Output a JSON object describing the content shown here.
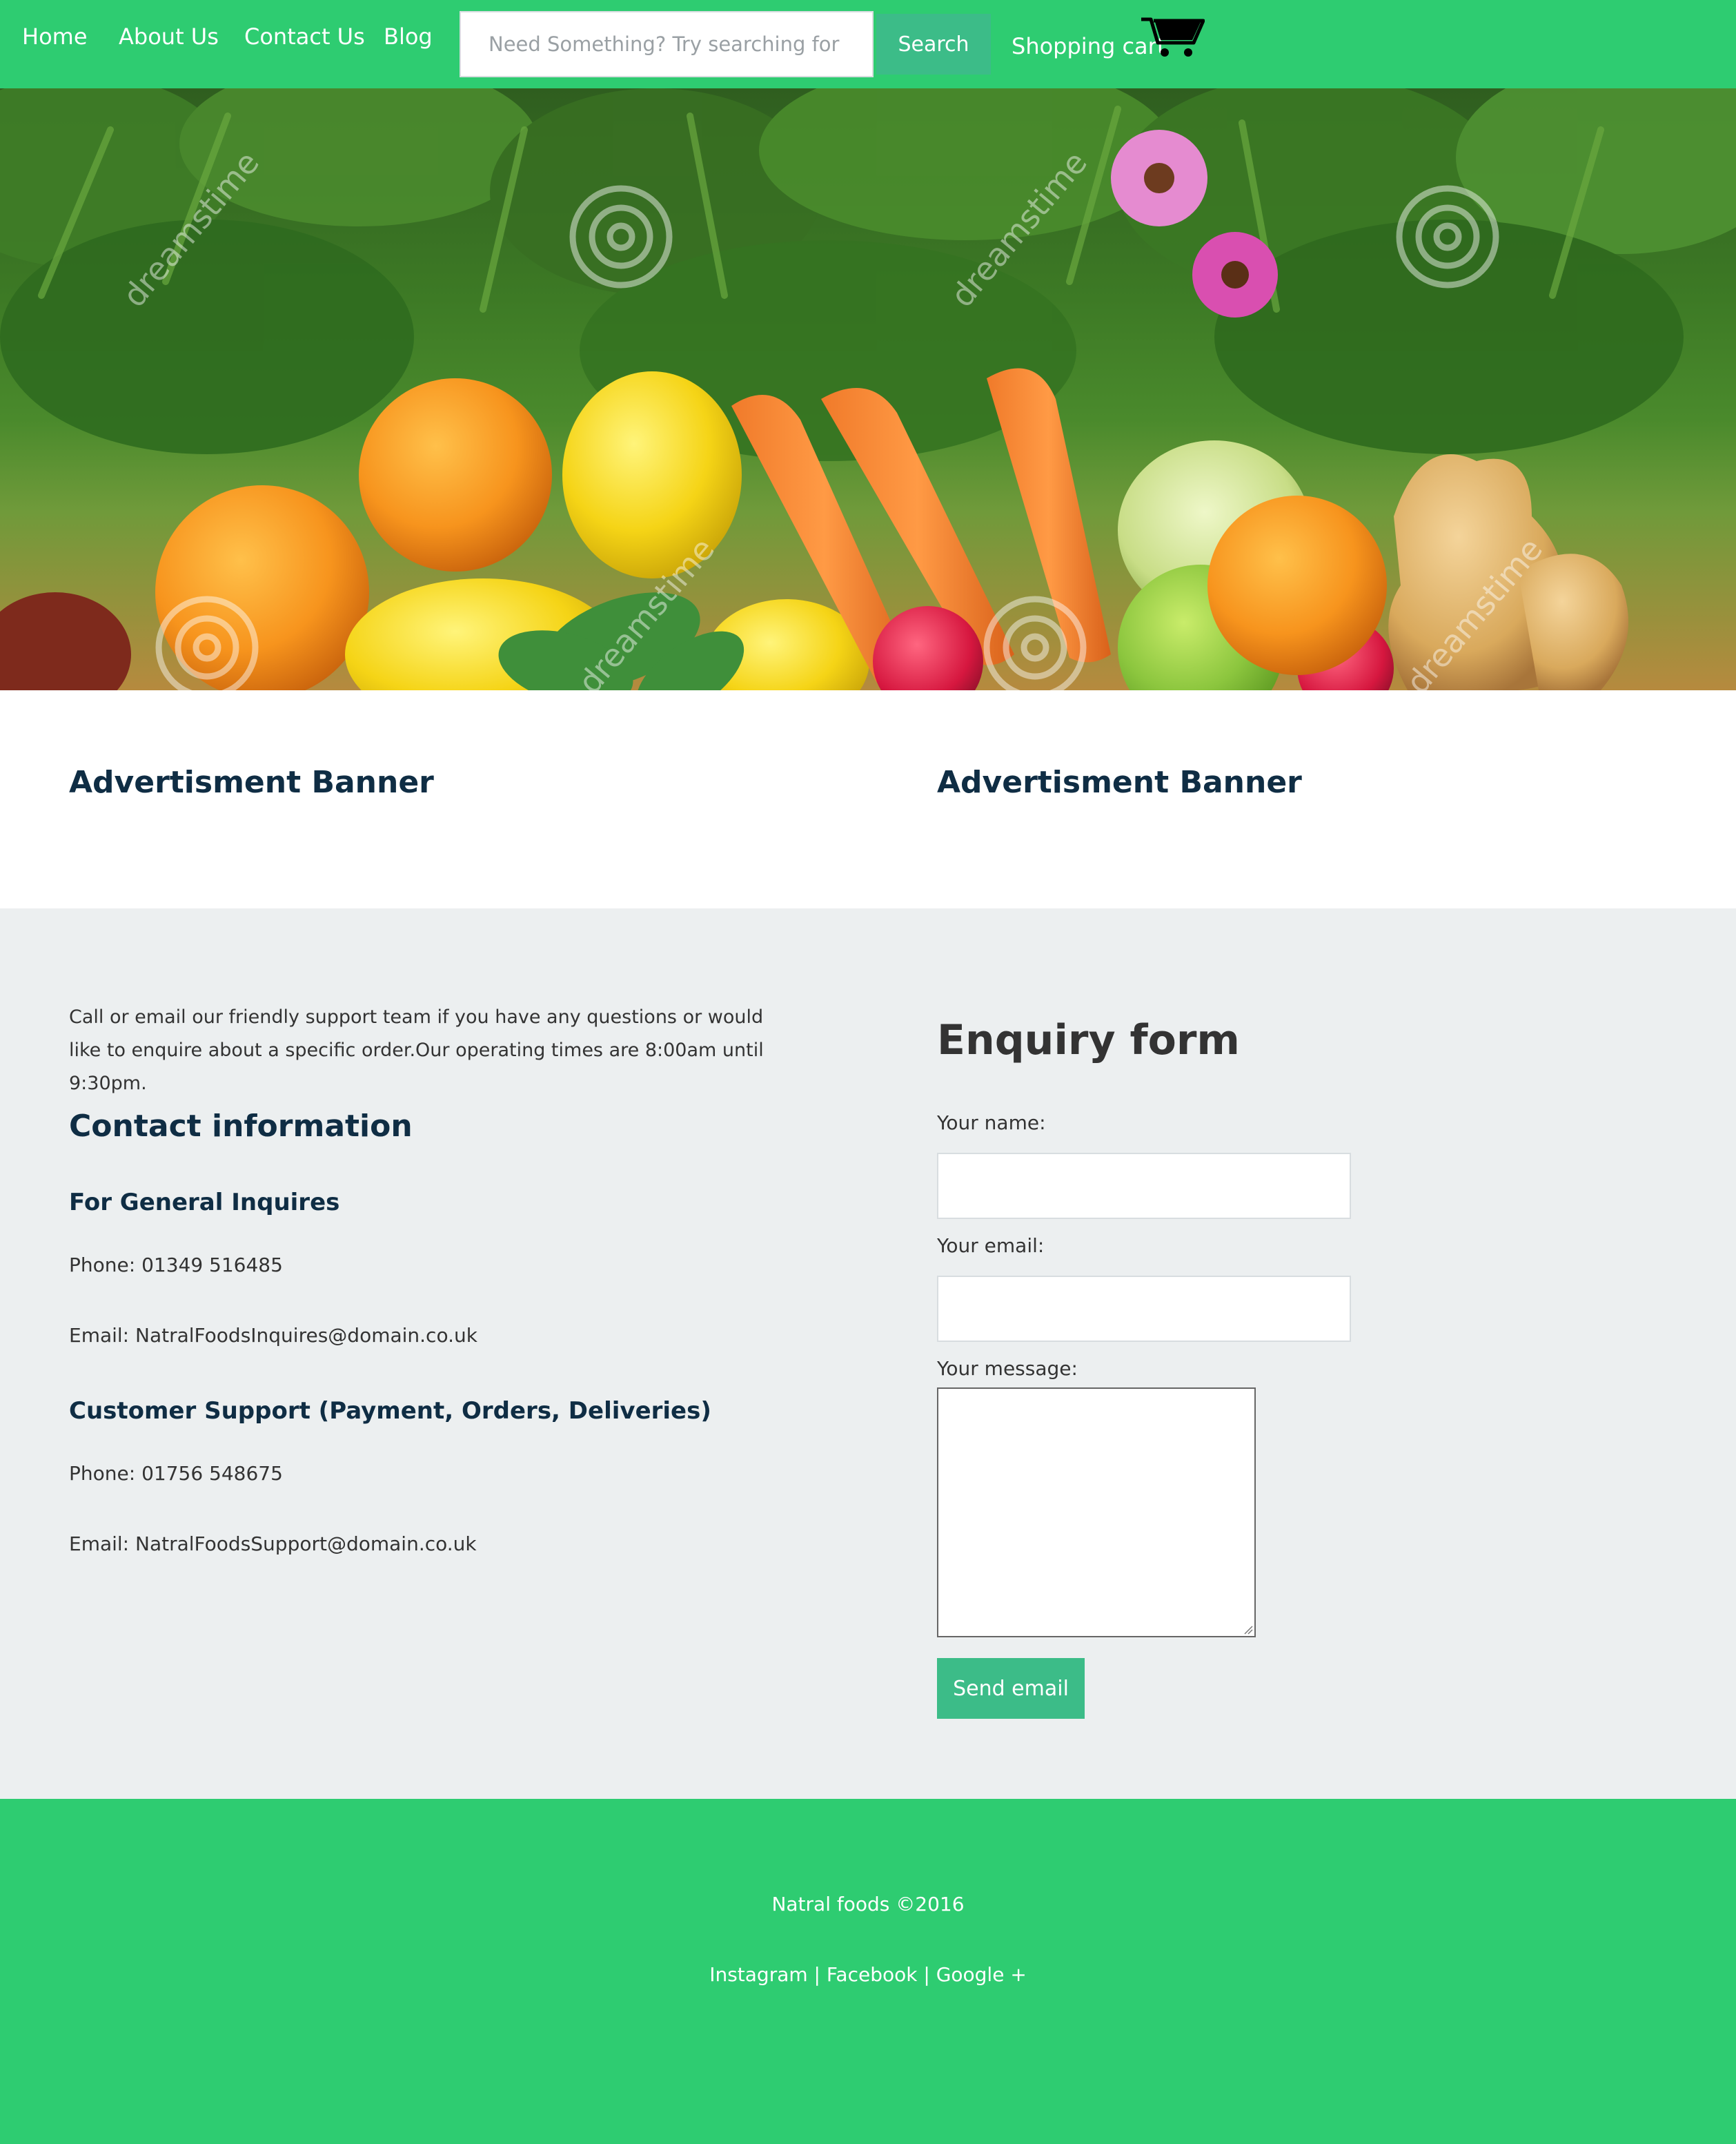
{
  "nav": {
    "home": "Home",
    "about": "About Us",
    "contact": "Contact Us",
    "blog": "Blog",
    "search_placeholder": "Need Something? Try searching for it?",
    "search_button": "Search",
    "cart": "Shopping cart",
    "cart_icon": "shopping-cart-icon"
  },
  "hero": {
    "image": "fruits-and-vegetables-photo",
    "watermark": "dreamstime"
  },
  "ads": {
    "left": "Advertisment Banner",
    "right": "Advertisment Banner"
  },
  "contact": {
    "intro": "Call or email our friendly support team if you have any questions or would like to enquire about a specific order.Our operating times are 8:00am until 9:30pm.",
    "heading": "Contact information",
    "general": {
      "heading": "For General Inquires",
      "phone": "Phone: 01349 516485",
      "email": "Email: NatralFoodsInquires@domain.co.uk"
    },
    "support": {
      "heading": "Customer Support (Payment, Orders, Deliveries)",
      "phone": "Phone: 01756 548675",
      "email": "Email: NatralFoodsSupport@domain.co.uk"
    }
  },
  "form": {
    "heading": "Enquiry form",
    "name_label": "Your name:",
    "email_label": "Your email:",
    "message_label": "Your message:",
    "name_value": "",
    "email_value": "",
    "send": "Send email"
  },
  "footer": {
    "copyright": "Natral foods ©2016",
    "instagram": "Instagram",
    "facebook": "Facebook",
    "google": "Google +",
    "separator": " | "
  },
  "colors": {
    "nav_green": "#2ecc71",
    "button_green": "#3cbc88",
    "heading_navy": "#0f2d44",
    "section_gray": "#eceff0"
  }
}
